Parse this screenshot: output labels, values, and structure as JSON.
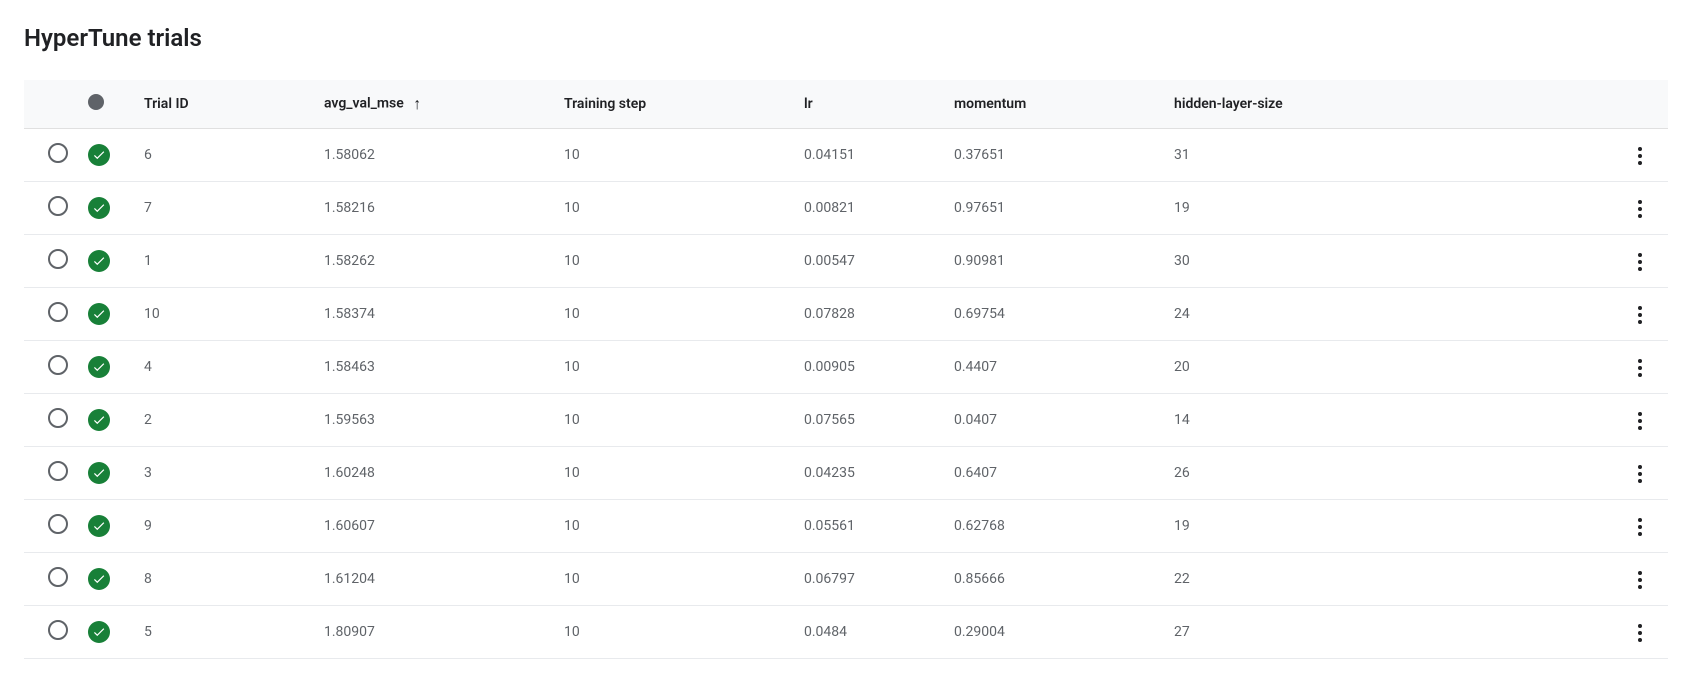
{
  "title": "HyperTune trials",
  "sort_arrow": "↑",
  "columns": {
    "trial_id": "Trial ID",
    "metric": "avg_val_mse",
    "training_step": "Training step",
    "lr": "lr",
    "momentum": "momentum",
    "hidden_layer_size": "hidden-layer-size"
  },
  "rows": [
    {
      "trial_id": "6",
      "metric": "1.58062",
      "training_step": "10",
      "lr": "0.04151",
      "momentum": "0.37651",
      "hidden_layer_size": "31"
    },
    {
      "trial_id": "7",
      "metric": "1.58216",
      "training_step": "10",
      "lr": "0.00821",
      "momentum": "0.97651",
      "hidden_layer_size": "19"
    },
    {
      "trial_id": "1",
      "metric": "1.58262",
      "training_step": "10",
      "lr": "0.00547",
      "momentum": "0.90981",
      "hidden_layer_size": "30"
    },
    {
      "trial_id": "10",
      "metric": "1.58374",
      "training_step": "10",
      "lr": "0.07828",
      "momentum": "0.69754",
      "hidden_layer_size": "24"
    },
    {
      "trial_id": "4",
      "metric": "1.58463",
      "training_step": "10",
      "lr": "0.00905",
      "momentum": "0.4407",
      "hidden_layer_size": "20"
    },
    {
      "trial_id": "2",
      "metric": "1.59563",
      "training_step": "10",
      "lr": "0.07565",
      "momentum": "0.0407",
      "hidden_layer_size": "14"
    },
    {
      "trial_id": "3",
      "metric": "1.60248",
      "training_step": "10",
      "lr": "0.04235",
      "momentum": "0.6407",
      "hidden_layer_size": "26"
    },
    {
      "trial_id": "9",
      "metric": "1.60607",
      "training_step": "10",
      "lr": "0.05561",
      "momentum": "0.62768",
      "hidden_layer_size": "19"
    },
    {
      "trial_id": "8",
      "metric": "1.61204",
      "training_step": "10",
      "lr": "0.06797",
      "momentum": "0.85666",
      "hidden_layer_size": "22"
    },
    {
      "trial_id": "5",
      "metric": "1.80907",
      "training_step": "10",
      "lr": "0.0484",
      "momentum": "0.29004",
      "hidden_layer_size": "27"
    }
  ]
}
